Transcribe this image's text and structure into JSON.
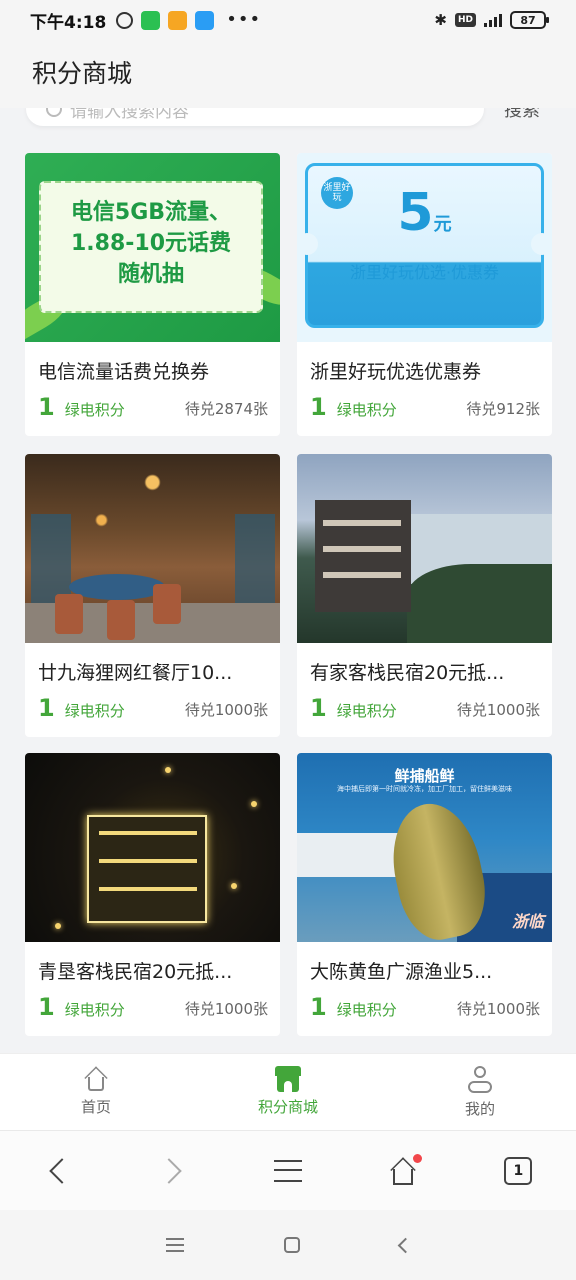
{
  "status_bar": {
    "time": "下午4:18",
    "network": "HD",
    "battery": "87"
  },
  "header": {
    "title": "积分商城"
  },
  "search": {
    "placeholder": "请输入搜索内容",
    "button_label": "搜索"
  },
  "products": [
    {
      "title": "电信流量话费兑换券",
      "price": "1",
      "unit": "绿电积分",
      "stock": "待兑2874张",
      "image_text": [
        "电信5GB流量、",
        "1.88-10元话费",
        "随机抽"
      ]
    },
    {
      "title": "浙里好玩优选优惠券",
      "price": "1",
      "unit": "绿电积分",
      "stock": "待兑912张",
      "image_text": {
        "amount": "5",
        "currency": "元",
        "subtitle": "浙里好玩优选·优惠券",
        "logo": "浙里好玩"
      }
    },
    {
      "title": "廿九海狸网红餐厅10...",
      "price": "1",
      "unit": "绿电积分",
      "stock": "待兑1000张"
    },
    {
      "title": "有家客栈民宿20元抵...",
      "price": "1",
      "unit": "绿电积分",
      "stock": "待兑1000张"
    },
    {
      "title": "青垦客栈民宿20元抵...",
      "price": "1",
      "unit": "绿电积分",
      "stock": "待兑1000张"
    },
    {
      "title": "大陈黄鱼广源渔业5...",
      "price": "1",
      "unit": "绿电积分",
      "stock": "待兑1000张",
      "image_text": {
        "headline": "鲜捕船鲜",
        "caption": "海中捕后即第一时间就冷冻，加工厂加工，留住鲜美滋味",
        "boat": "浙临"
      }
    }
  ],
  "tabbar": [
    {
      "label": "首页",
      "icon": "home-icon",
      "active": false
    },
    {
      "label": "积分商城",
      "icon": "shop-icon",
      "active": true
    },
    {
      "label": "我的",
      "icon": "user-icon",
      "active": false
    }
  ],
  "browser": {
    "tab_count": "1"
  },
  "colors": {
    "accent_green": "#43a63a",
    "background": "#f2f3f5"
  }
}
